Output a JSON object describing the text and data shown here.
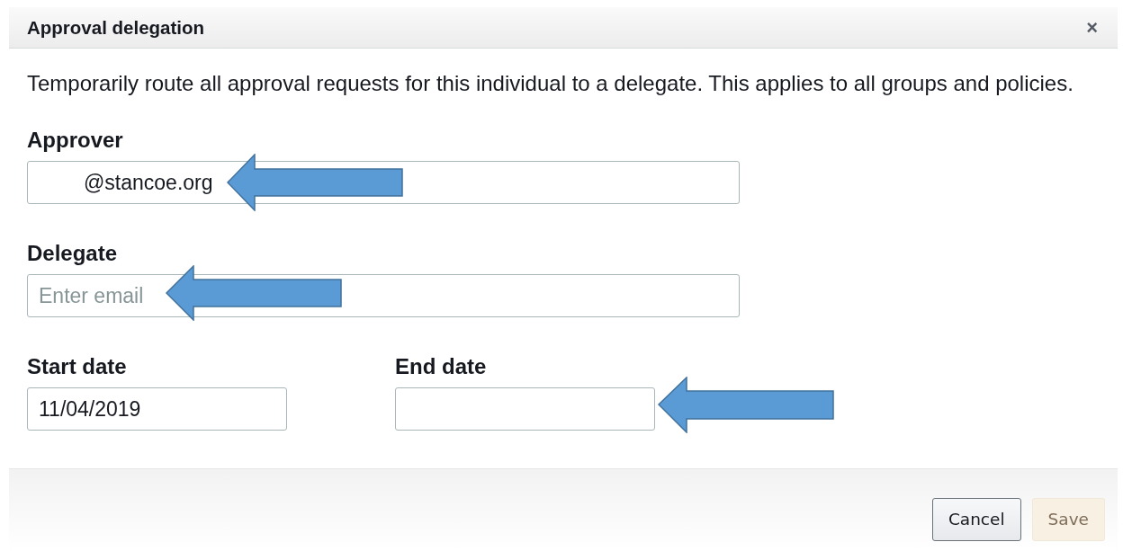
{
  "dialog": {
    "title": "Approval delegation",
    "close": "×"
  },
  "description": "Temporarily route all approval requests for this individual to a delegate. This applies to all groups and policies.",
  "fields": [
    {
      "label": "Approver",
      "value": "@stancoe.org",
      "redacted_prefix": true
    },
    {
      "label": "Delegate",
      "placeholder": "Enter email"
    }
  ],
  "dates": [
    {
      "label": "Start date",
      "value": "11/04/2019"
    },
    {
      "label": "End date"
    }
  ],
  "buttons": [
    {
      "label": "Cancel",
      "disabled": false
    },
    {
      "label": "Save",
      "disabled": true
    }
  ]
}
